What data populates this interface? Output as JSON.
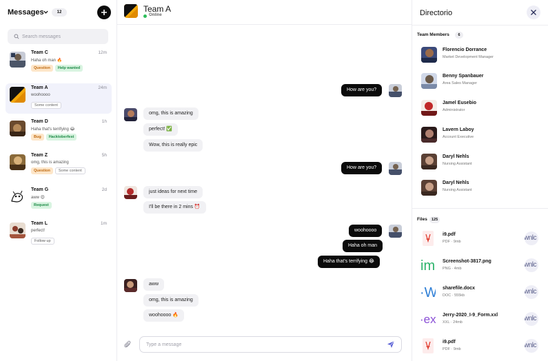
{
  "left": {
    "title": "Messages",
    "count": "12",
    "search_placeholder": "Search messages",
    "conversations": [
      {
        "name": "Team C",
        "time": "12m",
        "preview": "Haha oh man 🔥",
        "tags": [
          "Question",
          "Help wanted"
        ]
      },
      {
        "name": "Team A",
        "time": "24m",
        "preview": "woohoooo",
        "tags": [
          "Some content"
        ]
      },
      {
        "name": "Team D",
        "time": "1h",
        "preview": "Haha that's terrifying 😂",
        "tags": [
          "Bug",
          "Hacktoberfest"
        ]
      },
      {
        "name": "Team Z",
        "time": "5h",
        "preview": "omg, this is amazing",
        "tags": [
          "Question",
          "Some content"
        ]
      },
      {
        "name": "Team G",
        "time": "2d",
        "preview": "aww 😍",
        "tags": [
          "Request"
        ]
      },
      {
        "name": "Team L",
        "time": "1m",
        "preview": "perfect!",
        "tags": [
          "Follow up"
        ]
      }
    ]
  },
  "chat": {
    "title": "Team A",
    "status": "Online",
    "composer_placeholder": "Type a message",
    "messages": [
      {
        "dir": "out",
        "text": "How are you?"
      },
      {
        "dir": "in",
        "text": "omg, this is amazing"
      },
      {
        "dir": "in",
        "text": "perfect! ✅"
      },
      {
        "dir": "in",
        "text": "Wow, this is really epic"
      },
      {
        "dir": "out",
        "text": "How are you?"
      },
      {
        "dir": "in",
        "text": "just ideas for next time"
      },
      {
        "dir": "in",
        "text": "I'll be there in 2 mins ⏰"
      },
      {
        "dir": "out",
        "text": "woohoooo"
      },
      {
        "dir": "out",
        "text": "Haha oh man"
      },
      {
        "dir": "out",
        "text": "Haha that's terrifying 😂"
      },
      {
        "dir": "in",
        "text": "aww"
      },
      {
        "dir": "in",
        "text": "omg, this is amazing"
      },
      {
        "dir": "in",
        "text": "woohoooo 🔥"
      }
    ]
  },
  "directory": {
    "title": "Directorio",
    "members_label": "Team Members",
    "members_count": "6",
    "members": [
      {
        "name": "Florencio Dorrance",
        "role": "Market Development Manager"
      },
      {
        "name": "Benny Spanbauer",
        "role": "Area Sales Manager"
      },
      {
        "name": "Jamel Eusebio",
        "role": "Administrator"
      },
      {
        "name": "Lavern Laboy",
        "role": "Account Executive"
      },
      {
        "name": "Daryl Nehls",
        "role": "Nursing Assistant"
      },
      {
        "name": "Daryl Nehls",
        "role": "Nursing Assistant"
      }
    ],
    "files_label": "Files",
    "files_count": "125",
    "download_text": "wnlc",
    "files": [
      {
        "name": "i9.pdf",
        "meta": "PDF · 9mb",
        "icon": "pdf-icon"
      },
      {
        "name": "Screenshot-3817.png",
        "meta": "PNG · 4mb",
        "icon": "image-file-icon"
      },
      {
        "name": "sharefile.docx",
        "meta": "DOC · 555kb",
        "icon": "word-file-icon"
      },
      {
        "name": "Jerry-2020_I-9_Form.xxl",
        "meta": "XXL · 24mb",
        "icon": "excel-file-icon"
      },
      {
        "name": "i9.pdf",
        "meta": "PDF · 9mb",
        "icon": "pdf-icon"
      }
    ]
  },
  "colors": {
    "accent": "#5b61d6",
    "online": "#2fbf5c",
    "dark_bubble": "#0b0b0b"
  }
}
